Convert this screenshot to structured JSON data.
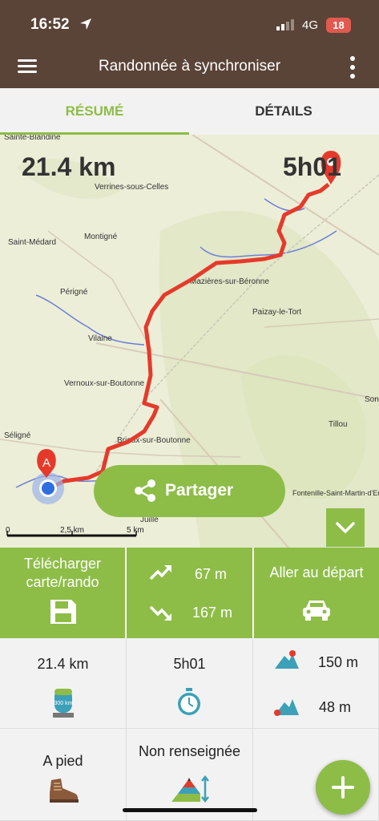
{
  "status": {
    "time": "16:52",
    "network": "4G",
    "battery": "18"
  },
  "appbar": {
    "title": "Randonnée à synchroniser"
  },
  "tabs": [
    {
      "label": "RÉSUMÉ"
    },
    {
      "label": "DÉTAILS"
    }
  ],
  "map": {
    "distance": "21.4 km",
    "duration": "5h01",
    "start_marker": "A",
    "share_label": "Partager",
    "scale": [
      "0",
      "2,5 km",
      "5 km"
    ],
    "places": [
      "Sainte-Blandine",
      "Verrines-sous-Celles",
      "Montigné",
      "Saint-Médard",
      "Mazières-sur-Béronne",
      "Périgné",
      "Vilaine",
      "Paizay-le-Tort",
      "Vernoux-sur-Boutonne",
      "Brioux-sur-Boutonne",
      "Tillou",
      "Séligné",
      "Fontenille-Saint-Martin-d'Entraigues",
      "Juillé",
      "Son"
    ]
  },
  "actions": {
    "download": [
      "Télécharger",
      "carte/rando"
    ],
    "ascent": "67 m",
    "descent": "167 m",
    "go_start": "Aller au départ"
  },
  "stats": {
    "distance": "21.4 km",
    "duration": "5h01",
    "alt_max": "150 m",
    "alt_min": "48 m",
    "activity": "A pied",
    "difficulty": "Non renseignée",
    "badge": "300 km"
  },
  "colors": {
    "brand_brown": "#5a4337",
    "accent_green": "#8dbd47",
    "route_red": "#e53a2b"
  }
}
